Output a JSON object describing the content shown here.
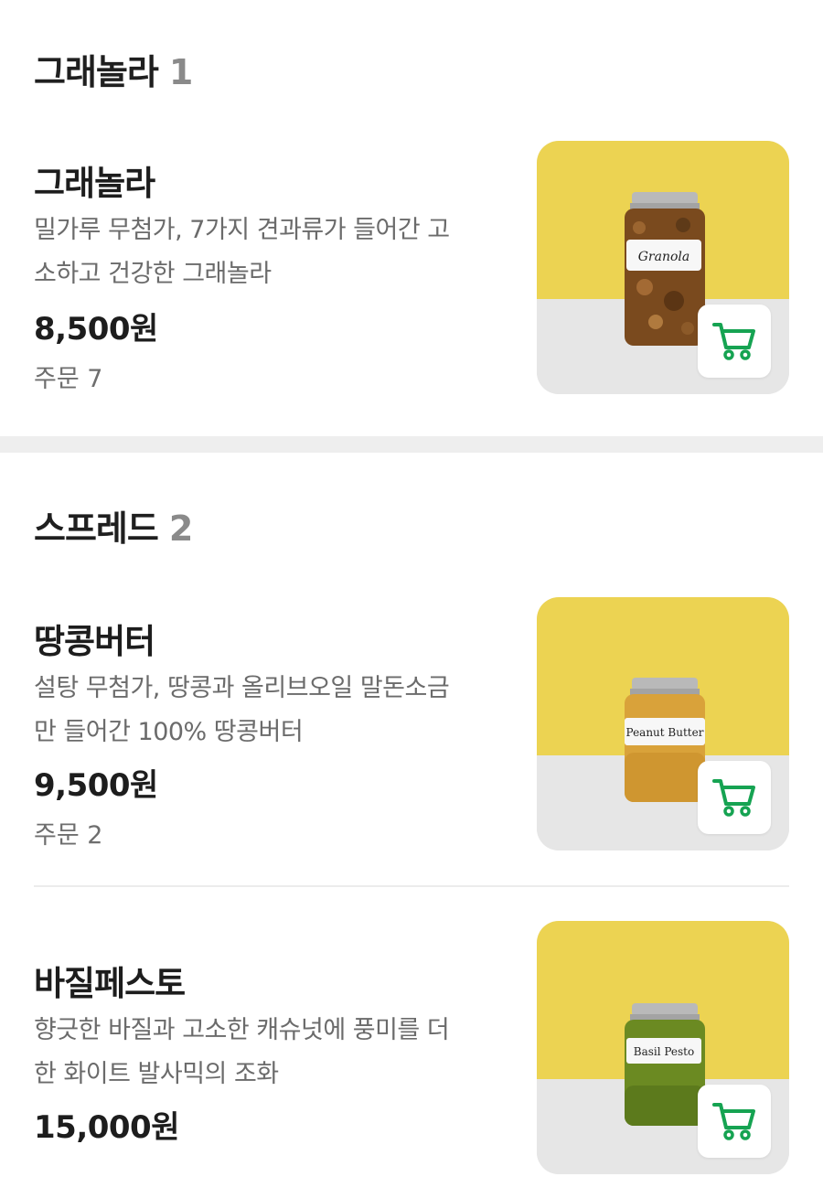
{
  "sections": [
    {
      "title": "그래놀라",
      "count": "1",
      "items": [
        {
          "name": "그래놀라",
          "desc_line1": "밀가루 무첨가, 7가지 견과류가 들어간 고",
          "desc_line2": "소하고 건강한 그래놀라",
          "price": "8,500원",
          "orders": "주문 7",
          "jar_label": "Granola",
          "jar_fill": "#7a4a1e"
        }
      ]
    },
    {
      "title": "스프레드",
      "count": "2",
      "items": [
        {
          "name": "땅콩버터",
          "desc_line1": "설탕 무첨가, 땅콩과 올리브오일 말돈소금",
          "desc_line2": "만 들어간 100% 땅콩버터",
          "price": "9,500원",
          "orders": "주문 2",
          "jar_label": "Peanut Butter",
          "jar_fill": "#d9a23a"
        },
        {
          "name": "바질페스토",
          "desc_line1": "향긋한 바질과 고소한 캐슈넛에 풍미를 더",
          "desc_line2": "한 화이트 발사믹의 조화",
          "price": "15,000원",
          "jar_label": "Basil Pesto",
          "jar_fill": "#6b8a22"
        }
      ]
    }
  ],
  "colors": {
    "thumb_top": "#ecd352",
    "thumb_bottom": "#e6e6e6",
    "cart_icon": "#16a352",
    "lid": "#b9b9b9"
  },
  "icons": {
    "cart": "shopping-cart-icon"
  }
}
